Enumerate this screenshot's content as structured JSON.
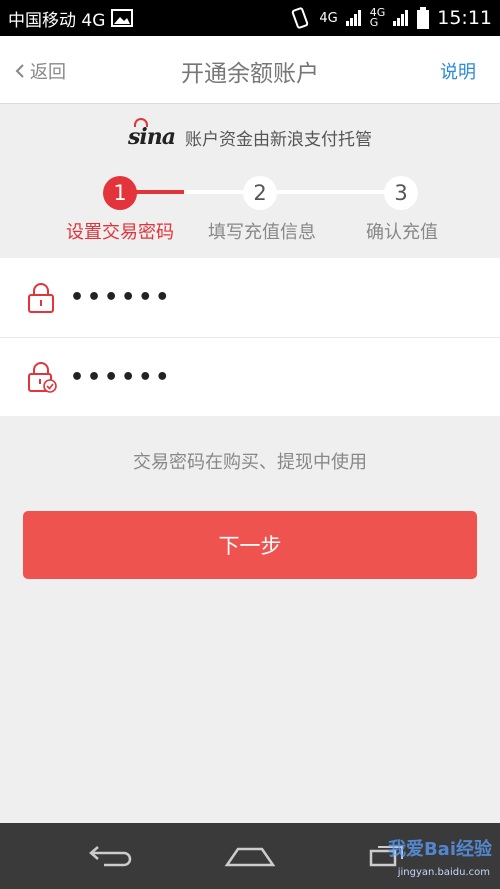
{
  "status_bar": {
    "carrier": "中国移动 4G",
    "net_1": "4G",
    "net_2_top": "4G",
    "net_2_bottom": "G",
    "time": "15:11"
  },
  "nav": {
    "back_label": "返回",
    "title": "开通余额账户",
    "help_label": "说明"
  },
  "trust": {
    "logo_text": "sina",
    "text": "账户资金由新浪支付托管"
  },
  "steps": [
    {
      "number": "1",
      "label": "设置交易密码",
      "active": true
    },
    {
      "number": "2",
      "label": "填写充值信息",
      "active": false
    },
    {
      "number": "3",
      "label": "确认充值",
      "active": false
    }
  ],
  "fields": {
    "password": {
      "value": "••••••"
    },
    "confirm_password": {
      "value": "••••••"
    }
  },
  "hint": "交易密码在购买、提现中使用",
  "next_button": "下一步",
  "watermark": {
    "text": "我爱Bai经验",
    "url": "jingyan.baidu.com"
  },
  "colors": {
    "accent": "#e2343a",
    "button": "#ef5350",
    "link": "#2a8bd8"
  }
}
